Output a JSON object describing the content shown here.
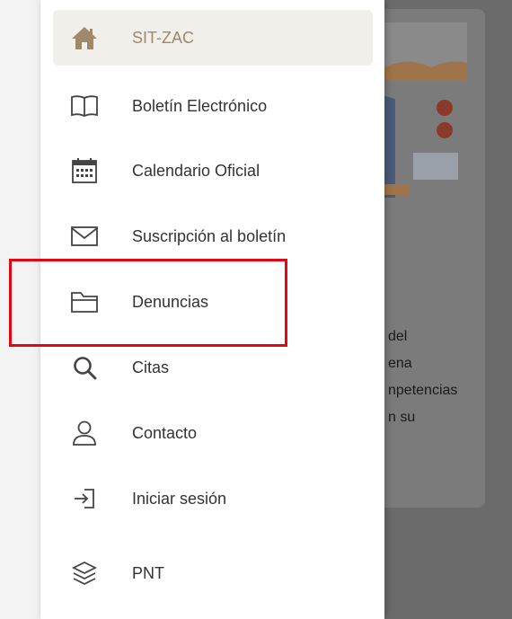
{
  "menu": {
    "items": [
      {
        "label": "SIT-ZAC",
        "icon": "home-icon",
        "active": true
      },
      {
        "label": "Boletín Electrónico",
        "icon": "book-icon",
        "active": false
      },
      {
        "label": "Calendario Oficial",
        "icon": "calendar-icon",
        "active": false
      },
      {
        "label": "Suscripción al boletín",
        "icon": "mail-icon",
        "active": false
      },
      {
        "label": "Denuncias",
        "icon": "folder-icon",
        "active": false
      },
      {
        "label": "Citas",
        "icon": "search-icon",
        "active": false
      },
      {
        "label": "Contacto",
        "icon": "user-icon",
        "active": false
      },
      {
        "label": "Iniciar sesión",
        "icon": "login-icon",
        "active": false
      },
      {
        "label": "PNT",
        "icon": "layers-icon",
        "active": false
      }
    ]
  },
  "background": {
    "text_lines": [
      "del",
      "ena",
      "npetencias",
      "n su"
    ]
  },
  "colors": {
    "active_bg": "#f1efea",
    "active_text": "#a0886a",
    "highlight": "#e30613"
  }
}
